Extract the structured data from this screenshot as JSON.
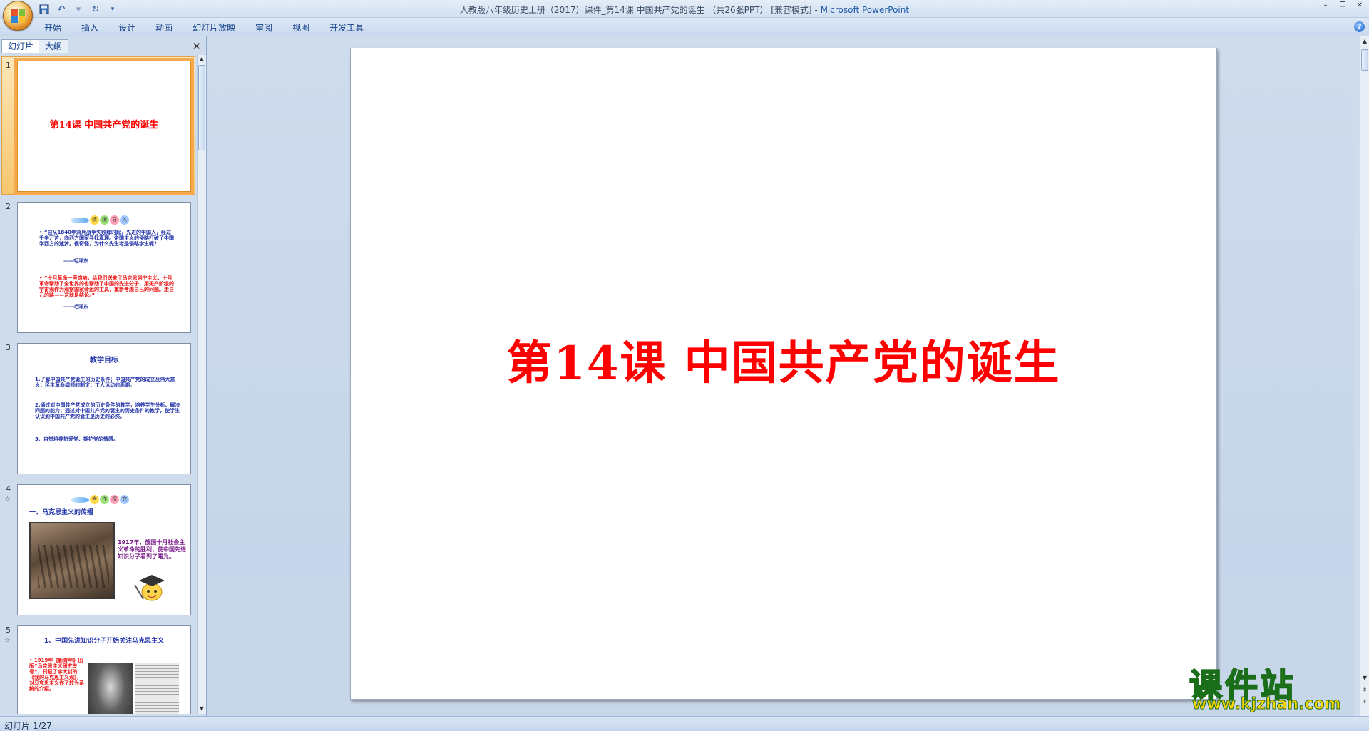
{
  "window": {
    "title": "人教版八年级历史上册（2017）课件_第14课 中国共产党的诞生 （共26张PPT） [兼容模式] - ",
    "app_name": "Microsoft PowerPoint",
    "minimize": "–",
    "restore": "❐",
    "close": "✕"
  },
  "ribbon": {
    "tabs": [
      "开始",
      "插入",
      "设计",
      "动画",
      "幻灯片放映",
      "审阅",
      "视图",
      "开发工具"
    ],
    "help": "?"
  },
  "slide_pane": {
    "tab_slides": "幻灯片",
    "tab_outline": "大纲",
    "close": "✕",
    "thumbnails": [
      {
        "number": "1",
        "title": "第14课  中国共产党的诞生"
      },
      {
        "number": "2",
        "banner": [
          "情",
          "境",
          "导",
          "入"
        ],
        "blue_text": "•  “自从1840年鸦片战争失败那时起，先进的中国人，经过千辛万苦，向西方国家寻找真理。帝国主义的侵略打破了中国学西方的迷梦。很奇怪，为什么先生老是侵略学生呢？",
        "blue_sig": "——毛泽东",
        "red_text": "•  “十月革命一声炮响，给我们送来了马克思列宁主义。十月革命帮助了全世界的也帮助了中国的先进分子，用无产阶级的宇宙观作为观察国家命运的工具，重新考虑自己的问题。走自己的路——这就是结论。”",
        "red_sig": "——毛泽东"
      },
      {
        "number": "3",
        "heading": "教学目标",
        "items": [
          "1.了解中国共产党诞生的历史条件；中国共产党的成立及伟大意义；民主革命纲领的制定；工人运动的高潮。",
          "2.通过对中国共产党成立的历史条件的教学，培养学生分析、解决问题的能力；通过对中国共产党的诞生的历史条件的教学，使学生认识到中国共产党的诞生是历史的必然。",
          "3、自觉培养热爱党、拥护党的情感。"
        ]
      },
      {
        "number": "4",
        "anim": "☆",
        "banner": [
          "合",
          "作",
          "探",
          "究"
        ],
        "heading": "一、马克思主义的传播",
        "caption": "1917年，俄国十月社会主义革命的胜利，使中国先进知识分子看到了曙光。"
      },
      {
        "number": "5",
        "anim": "☆",
        "heading": "1、中国先进知识分子开始关注马克思主义",
        "text": "• 1919年《新青年》出版“马克思主义研究专号”，刊载了李大钊的《我的马克思主义观》，对马克思主义作了较为系统的介绍。"
      }
    ]
  },
  "slide": {
    "title": "第14课  中国共产党的诞生"
  },
  "status_bar": {
    "text": "幻灯片 1/27"
  },
  "watermark": {
    "title": "课件站",
    "url": "www.kjzhan.com"
  },
  "colors": {
    "title_red": "#ff0000",
    "thumb_blue": "#2233aa",
    "selected_orange": "#f6a94d"
  }
}
